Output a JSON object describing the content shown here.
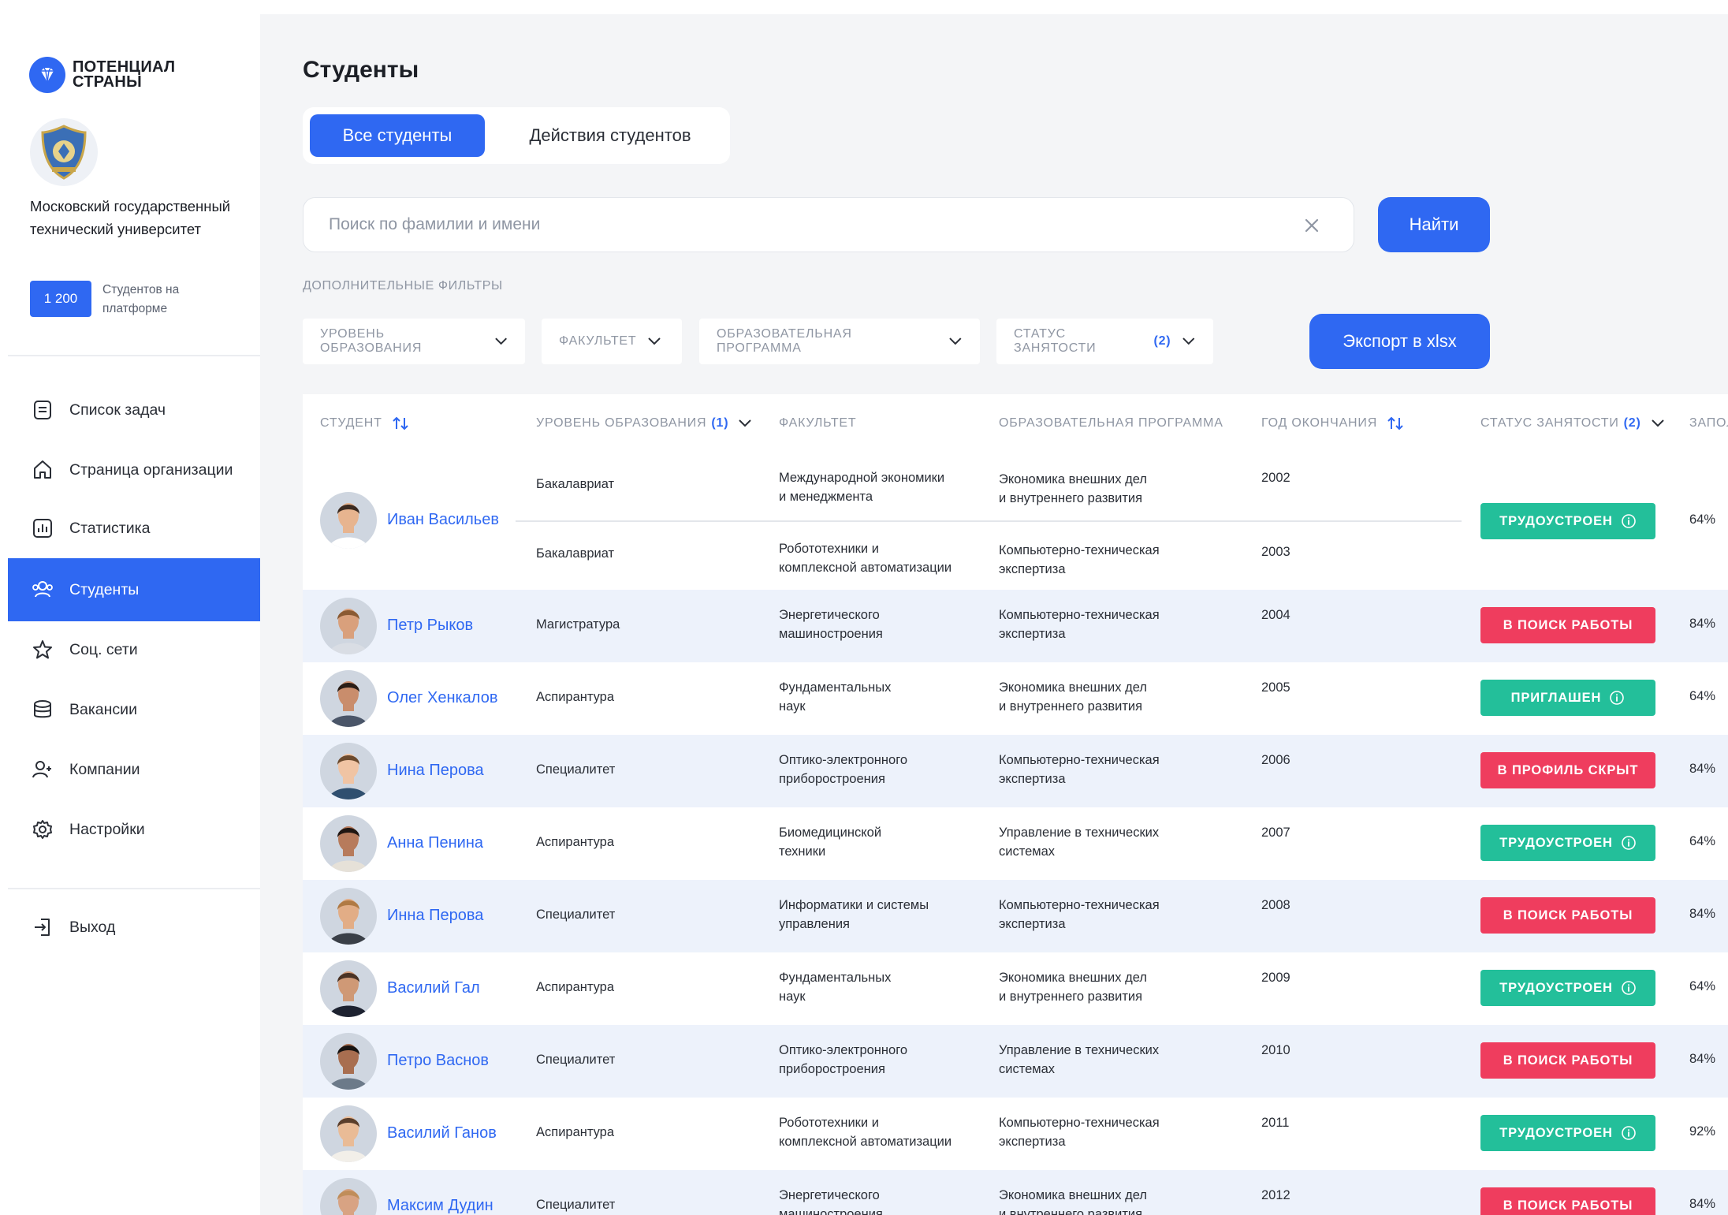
{
  "brand": {
    "logo_text": "ПОТЕНЦИАЛ СТРАНЫ",
    "logo_icon": "diamond-icon",
    "accent": "#2f68f2"
  },
  "university": {
    "name": "Московский государственный технический университет",
    "students_count": "1 200",
    "students_label": "Студентов на платформе"
  },
  "nav": {
    "items": [
      {
        "label": "Список задач",
        "icon": "task-list-icon"
      },
      {
        "label": "Страница организации",
        "icon": "home-icon"
      },
      {
        "label": "Статистика",
        "icon": "chart-icon"
      },
      {
        "label": "Студенты",
        "icon": "users-icon",
        "active": true
      },
      {
        "label": "Соц. сети",
        "icon": "star-icon"
      },
      {
        "label": "Вакансии",
        "icon": "database-icon"
      },
      {
        "label": "Компании",
        "icon": "add-user-icon"
      },
      {
        "label": "Настройки",
        "icon": "gear-icon"
      }
    ],
    "logout": {
      "label": "Выход",
      "icon": "logout-icon"
    }
  },
  "page": {
    "title": "Студенты",
    "tabs": [
      {
        "label": "Все студенты",
        "active": true
      },
      {
        "label": "Действия студентов",
        "active": false
      }
    ]
  },
  "search": {
    "placeholder": "Поиск по фамилии и имени",
    "value": "",
    "button": "Найти"
  },
  "filters": {
    "title": "ДОПОЛНИТЕЛЬНЫЕ ФИЛЬТРЫ",
    "items": [
      {
        "label": "УРОВЕНЬ ОБРАЗОВАНИЯ",
        "count": ""
      },
      {
        "label": "ФАКУЛЬТЕТ",
        "count": ""
      },
      {
        "label": "ОБРАЗОВАТЕЛЬНАЯ ПРОГРАММА",
        "count": ""
      },
      {
        "label": "СТАТУС ЗАНЯТОСТИ",
        "count": "(2)"
      }
    ],
    "export": "Экспорт в xlsx"
  },
  "table": {
    "columns": [
      {
        "label": "СТУДЕНТ",
        "count": "",
        "sort": true
      },
      {
        "label": "УРОВЕНЬ ОБРАЗОВАНИЯ",
        "count": "(1)",
        "dropdown": true
      },
      {
        "label": "ФАКУЛЬТЕТ",
        "count": ""
      },
      {
        "label": "ОБРАЗОВАТЕЛЬНАЯ ПРОГРАММА",
        "count": ""
      },
      {
        "label": "ГОД ОКОНЧАНИЯ",
        "count": "",
        "sort": true
      },
      {
        "label": "СТАТУС ЗАНЯТОСТИ",
        "count": "(2)",
        "dropdown": true
      },
      {
        "label": "ЗАПОЛ",
        "count": ""
      }
    ],
    "first_row": {
      "name": "Иван Васильев",
      "status": "ТРУДОУСТРОЕН",
      "status_color": "green",
      "percent": "64%",
      "entries": [
        {
          "level": "Бакалавриат",
          "faculty": [
            "Международной экономики",
            "и менеджмента"
          ],
          "program": [
            "Экономика внешних дел",
            "и внутреннего развития"
          ],
          "year": "2002"
        },
        {
          "level": "Бакалавриат",
          "faculty": [
            "Робототехники и",
            "комплексной автоматизации"
          ],
          "program": [
            "Компьютерно-техническая",
            "экспертиза"
          ],
          "year": "2003"
        }
      ]
    },
    "rows": [
      {
        "name": "Петр Рыков",
        "level": "Магистратура",
        "faculty": [
          "Энергетического",
          "машиностроения"
        ],
        "program": [
          "Компьютерно-техническая",
          "экспертиза"
        ],
        "year": "2004",
        "status": "В ПОИСК РАБОТЫ",
        "status_color": "red",
        "info": false,
        "percent": "84%"
      },
      {
        "name": "Олег Хенкалов",
        "level": "Аспирантура",
        "faculty": [
          "Фундаментальных",
          "наук"
        ],
        "program": [
          "Экономика внешних дел",
          "и внутреннего развития"
        ],
        "year": "2005",
        "status": "ПРИГЛАШЕН",
        "status_color": "green",
        "info": true,
        "percent": "64%"
      },
      {
        "name": "Нина Перова",
        "level": "Специалитет",
        "faculty": [
          "Оптико-электронного",
          "приборостроения"
        ],
        "program": [
          "Компьютерно-техническая",
          "экспертиза"
        ],
        "year": "2006",
        "status": "В ПРОФИЛЬ СКРЫТ",
        "status_color": "red",
        "info": false,
        "percent": "84%"
      },
      {
        "name": "Анна Пенина",
        "level": "Аспирантура",
        "faculty": [
          "Биомедицинской",
          "техники"
        ],
        "program": [
          "Управление в технических",
          "системах"
        ],
        "year": "2007",
        "status": "ТРУДОУСТРОЕН",
        "status_color": "green",
        "info": true,
        "percent": "64%"
      },
      {
        "name": "Инна Перова",
        "level": "Специалитет",
        "faculty": [
          "Информатики и системы",
          "управления"
        ],
        "program": [
          "Компьютерно-техническая",
          "экспертиза"
        ],
        "year": "2008",
        "status": "В ПОИСК РАБОТЫ",
        "status_color": "red",
        "info": false,
        "percent": "84%"
      },
      {
        "name": "Василий Гал",
        "level": "Аспирантура",
        "faculty": [
          "Фундаментальных",
          "наук"
        ],
        "program": [
          "Экономика внешних дел",
          "и внутреннего развития"
        ],
        "year": "2009",
        "status": "ТРУДОУСТРОЕН",
        "status_color": "green",
        "info": true,
        "percent": "64%"
      },
      {
        "name": "Петро Васнов",
        "level": "Специалитет",
        "faculty": [
          "Оптико-электронного",
          "приборостроения"
        ],
        "program": [
          "Управление в технических",
          "системах"
        ],
        "year": "2010",
        "status": "В ПОИСК РАБОТЫ",
        "status_color": "red",
        "info": false,
        "percent": "84%"
      },
      {
        "name": "Василий Ганов",
        "level": "Аспирантура",
        "faculty": [
          "Робототехники и",
          "комплексной автоматизации"
        ],
        "program": [
          "Компьютерно-техническая",
          "экспертиза"
        ],
        "year": "2011",
        "status": "ТРУДОУСТРОЕН",
        "status_color": "green",
        "info": true,
        "percent": "92%"
      },
      {
        "name": "Максим Дудин",
        "level": "Специалитет",
        "faculty": [
          "Энергетического",
          "машиностроения"
        ],
        "program": [
          "Экономика внешних дел",
          "и внутреннего развития"
        ],
        "year": "2012",
        "status": "В ПОИСК РАБОТЫ",
        "status_color": "red",
        "info": false,
        "percent": "84%"
      }
    ]
  }
}
